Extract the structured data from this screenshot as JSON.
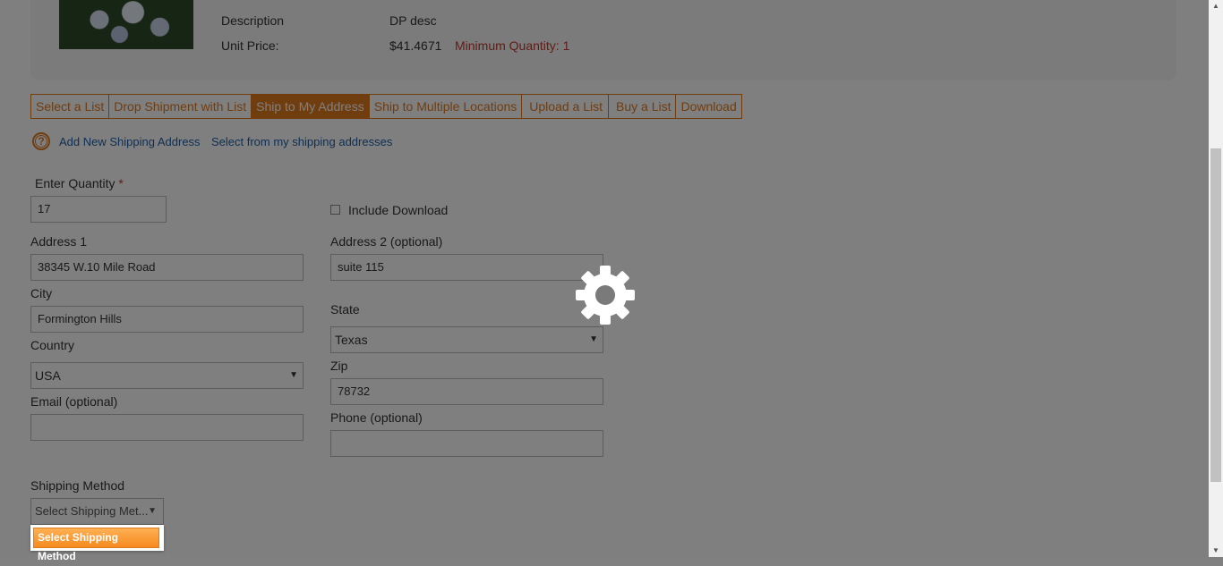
{
  "product": {
    "desc_label": "Description",
    "desc_value": "DP desc",
    "price_label": "Unit Price:",
    "price_value": "$41.4671",
    "min_qty": "Minimum Quantity: 1"
  },
  "tabs": [
    {
      "label": "Select a List"
    },
    {
      "label": "Drop Shipment with List"
    },
    {
      "label": "Ship to My Address"
    },
    {
      "label": "Upload a List"
    },
    {
      "label": "Buy a List"
    },
    {
      "label": "Download"
    }
  ],
  "tab_multi": "Ship to Multiple Locations",
  "links": {
    "add_address": "Add New Shipping Address",
    "select_address": "Select from my shipping addresses"
  },
  "form": {
    "quantity_label": "Enter Quantity",
    "required_mark": "*",
    "quantity_value": "17",
    "include_download": "Include Download",
    "address1_label": "Address 1",
    "address1_value": "38345 W.10 Mile Road",
    "address2_label": "Address 2 (optional)",
    "address2_value": "suite 115",
    "city_label": "City",
    "city_value": "Formington Hills",
    "state_label": "State",
    "state_value": "Texas",
    "country_label": "Country",
    "country_value": "USA",
    "zip_label": "Zip",
    "zip_value": "78732",
    "email_label": "Email (optional)",
    "email_value": "",
    "phone_label": "Phone (optional)",
    "phone_value": "",
    "shipping_label": "Shipping Method",
    "shipping_select": "Select Shipping Met...",
    "shipping_button": "Select Shipping Method"
  },
  "colors": {
    "accent": "#e07a1e",
    "error": "#c0392b",
    "link": "#1e5fa8"
  },
  "icons": {
    "help": "question-circle-icon",
    "spinner": "gear-icon",
    "caret": "caret-down-icon"
  }
}
